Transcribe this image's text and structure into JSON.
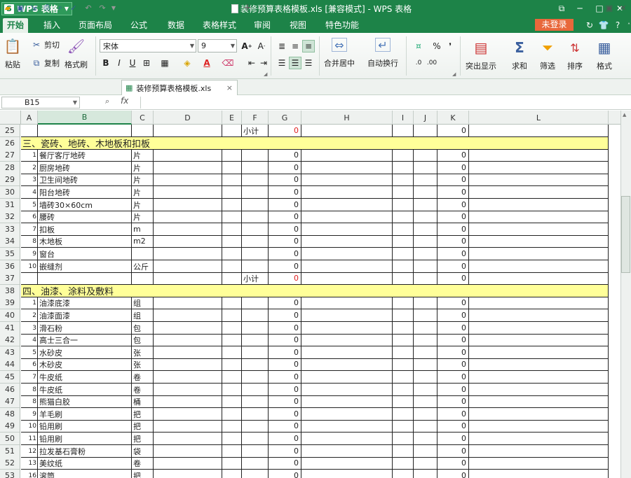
{
  "app": {
    "logo_glyph": "S",
    "name": "WPS 表格",
    "window_title": "装修预算表格模板.xls [兼容模式] - WPS 表格"
  },
  "window_controls": {
    "restore": "⧉",
    "minimize": "─",
    "maximize": "□",
    "close": "✕"
  },
  "menu": {
    "tabs": [
      "开始",
      "插入",
      "页面布局",
      "公式",
      "数据",
      "表格样式",
      "审阅",
      "视图",
      "特色功能"
    ],
    "active": "开始",
    "login": "未登录"
  },
  "ribbon": {
    "paste": "粘贴",
    "cut": "剪切",
    "copy": "复制",
    "format_painter": "格式刷",
    "font_name": "宋体",
    "font_size": "9",
    "bold": "B",
    "italic": "I",
    "underline": "U",
    "merge_center": "合并居中",
    "wrap_text": "自动换行",
    "percent": "%",
    "comma": "❜",
    "highlight": "突出显示",
    "sum": "求和",
    "filter": "筛选",
    "sort": "排序",
    "format": "格式"
  },
  "document": {
    "tab_label": "装修预算表格模板.xls",
    "close": "×",
    "new_tab": "+"
  },
  "formula_bar": {
    "cell_ref": "B15",
    "fx": "fx",
    "content": ""
  },
  "columns": [
    "A",
    "B",
    "C",
    "D",
    "E",
    "F",
    "G",
    "H",
    "I",
    "J",
    "K",
    "L"
  ],
  "selected_column": "B",
  "rows": [
    {
      "n": "25",
      "type": "subtotal",
      "f": "小计",
      "g": "0",
      "g_red": true,
      "k": "0"
    },
    {
      "n": "26",
      "type": "section",
      "text": "三、瓷砖、地砖、木地板和扣板"
    },
    {
      "n": "27",
      "type": "item",
      "a": "1",
      "b": "餐厅客厅地砖",
      "c": "片",
      "g": "0",
      "k": "0"
    },
    {
      "n": "28",
      "type": "item",
      "a": "2",
      "b": "厨房地砖",
      "c": "片",
      "g": "0",
      "k": "0"
    },
    {
      "n": "29",
      "type": "item",
      "a": "3",
      "b": "卫生间地砖",
      "c": "片",
      "g": "0",
      "k": "0"
    },
    {
      "n": "30",
      "type": "item",
      "a": "4",
      "b": "阳台地砖",
      "c": "片",
      "g": "0",
      "k": "0"
    },
    {
      "n": "31",
      "type": "item",
      "a": "5",
      "b": "墙砖30×60cm",
      "c": "片",
      "g": "0",
      "k": "0"
    },
    {
      "n": "32",
      "type": "item",
      "a": "6",
      "b": "腰砖",
      "c": "片",
      "g": "0",
      "k": "0"
    },
    {
      "n": "33",
      "type": "item",
      "a": "7",
      "b": "扣板",
      "c": "m",
      "g": "0",
      "k": "0"
    },
    {
      "n": "34",
      "type": "item",
      "a": "8",
      "b": "木地板",
      "c": "m2",
      "g": "0",
      "k": "0"
    },
    {
      "n": "35",
      "type": "item",
      "a": "9",
      "b": "窗台",
      "c": "",
      "g": "0",
      "k": "0"
    },
    {
      "n": "36",
      "type": "item",
      "a": "10",
      "b": "嵌缝剂",
      "c": "公斤",
      "g": "0",
      "k": "0"
    },
    {
      "n": "37",
      "type": "subtotal",
      "f": "小计",
      "g": "0",
      "g_red": true,
      "k": "0"
    },
    {
      "n": "38",
      "type": "section",
      "text": "四、油漆、涂料及敷料"
    },
    {
      "n": "39",
      "type": "item",
      "a": "1",
      "b": "油漆底漆",
      "c": "组",
      "g": "0",
      "k": "0"
    },
    {
      "n": "40",
      "type": "item",
      "a": "2",
      "b": "油漆面漆",
      "c": "组",
      "g": "0",
      "k": "0"
    },
    {
      "n": "41",
      "type": "item",
      "a": "3",
      "b": "滑石粉",
      "c": "包",
      "g": "0",
      "k": "0"
    },
    {
      "n": "42",
      "type": "item",
      "a": "4",
      "b": "高士三合一",
      "c": "包",
      "g": "0",
      "k": "0"
    },
    {
      "n": "43",
      "type": "item",
      "a": "5",
      "b": "水砂皮",
      "c": "张",
      "g": "0",
      "k": "0"
    },
    {
      "n": "44",
      "type": "item",
      "a": "6",
      "b": "木砂皮",
      "c": "张",
      "g": "0",
      "k": "0"
    },
    {
      "n": "45",
      "type": "item",
      "a": "7",
      "b": "牛皮纸",
      "c": "卷",
      "g": "0",
      "k": "0"
    },
    {
      "n": "46",
      "type": "item",
      "a": "8",
      "b": "牛皮纸",
      "c": "卷",
      "g": "0",
      "k": "0"
    },
    {
      "n": "47",
      "type": "item",
      "a": "8",
      "b": "熊猫白胶",
      "c": "桶",
      "g": "0",
      "k": "0"
    },
    {
      "n": "48",
      "type": "item",
      "a": "9",
      "b": "羊毛刷",
      "c": "把",
      "g": "0",
      "k": "0"
    },
    {
      "n": "49",
      "type": "item",
      "a": "10",
      "b": "铅用刷",
      "c": "把",
      "g": "0",
      "k": "0"
    },
    {
      "n": "50",
      "type": "item",
      "a": "11",
      "b": "铅用刷",
      "c": "把",
      "g": "0",
      "k": "0"
    },
    {
      "n": "51",
      "type": "item",
      "a": "12",
      "b": "拉发基石膏粉",
      "c": "袋",
      "g": "0",
      "k": "0"
    },
    {
      "n": "52",
      "type": "item",
      "a": "13",
      "b": "美纹纸",
      "c": "卷",
      "g": "0",
      "k": "0"
    },
    {
      "n": "53",
      "type": "item",
      "a": "16",
      "b": "滚筒",
      "c": "把",
      "g": "0",
      "k": "0"
    }
  ]
}
